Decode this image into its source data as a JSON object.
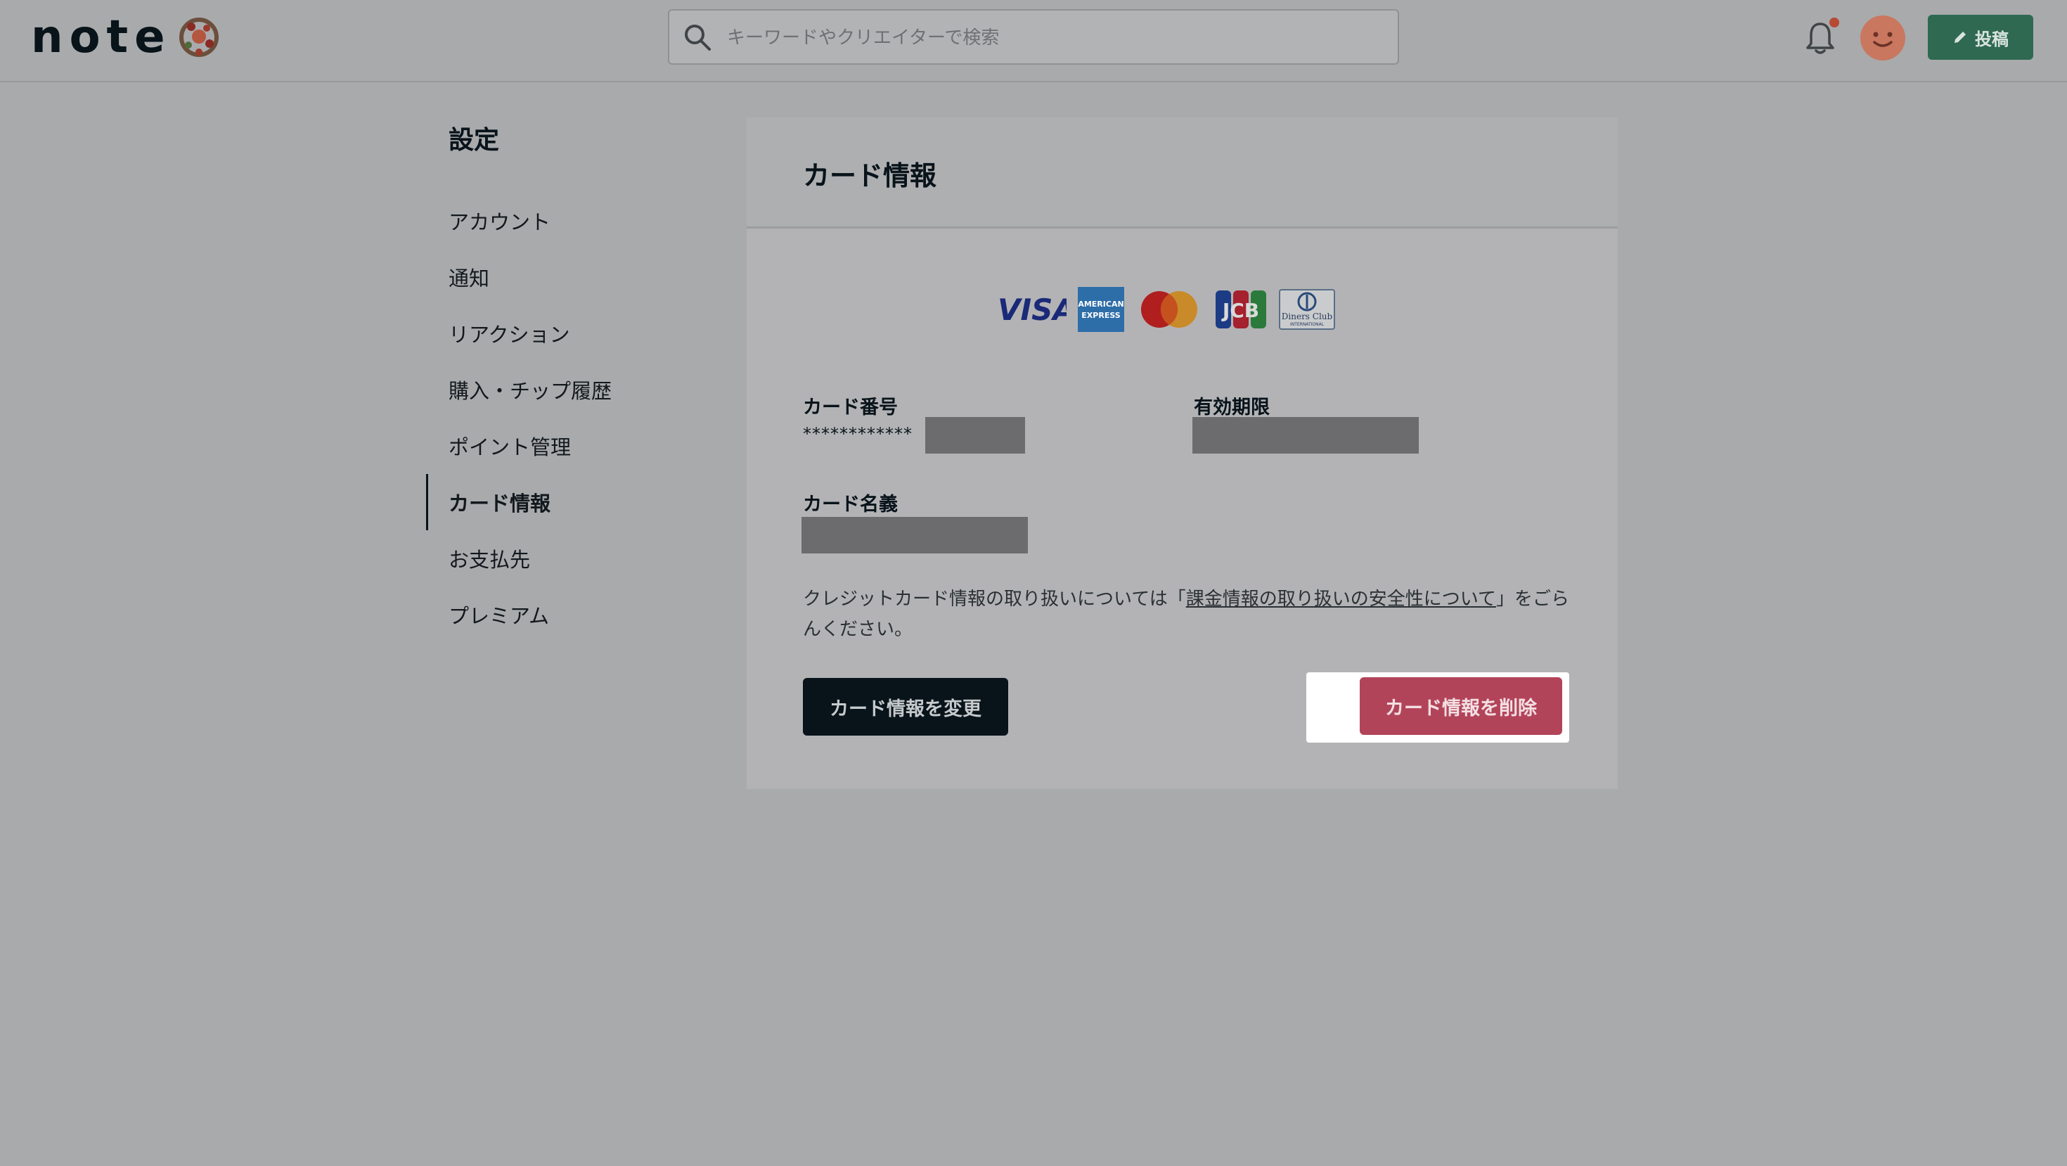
{
  "header": {
    "logo_text": "note",
    "search_placeholder": "キーワードやクリエイターで検索",
    "post_label": "投稿"
  },
  "sidebar": {
    "title": "設定",
    "items": [
      {
        "label": "アカウント"
      },
      {
        "label": "通知"
      },
      {
        "label": "リアクション"
      },
      {
        "label": "購入・チップ履歴"
      },
      {
        "label": "ポイント管理"
      },
      {
        "label": "カード情報",
        "active": true
      },
      {
        "label": "お支払先"
      },
      {
        "label": "プレミアム"
      }
    ]
  },
  "card": {
    "title": "カード情報",
    "brands": [
      "visa-logo",
      "amex-logo",
      "mastercard-logo",
      "jcb-logo",
      "diners-club-logo"
    ],
    "visa_text": "VISA",
    "amex_text": "AMERICAN EXPRESS",
    "jcb_text": "JCB",
    "diners_text": "Diners Club",
    "diners_subtext": "INTERNATIONAL",
    "number_label": "カード番号",
    "number_masked": "************",
    "expiry_label": "有効期限",
    "holder_label": "カード名義",
    "notice_before": "クレジットカード情報の取り扱いについては「",
    "notice_link": "課金情報の取り扱いの安全性について",
    "notice_after": "」をごらんください。",
    "change_button": "カード情報を変更",
    "delete_button": "カード情報を削除"
  },
  "colors": {
    "overlay_bg": "#a9aaac",
    "post_button": "#2f6952",
    "delete_button": "#b2445a",
    "change_button": "#08131a"
  }
}
